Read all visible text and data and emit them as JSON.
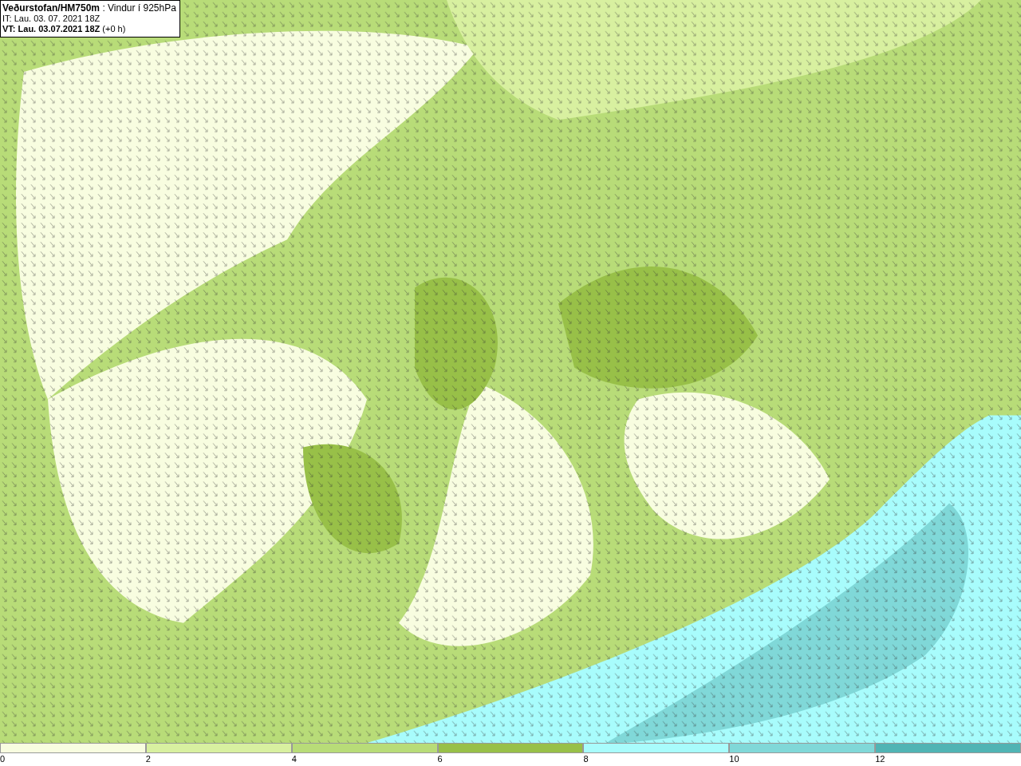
{
  "header": {
    "lines": [
      "**Veðurstofan/HM750m** : Vindur í 925hPa",
      "IT: Lau. 03. 07. 2021 18Z",
      "**VT: Lau. 03.07.2021 18Z** (+0 h)"
    ]
  },
  "legend": [
    {
      "label": "0",
      "color": "#f8fde0"
    },
    {
      "label": "2",
      "color": "#d8f0a0"
    },
    {
      "label": "4",
      "color": "#b8dc78"
    },
    {
      "label": "6",
      "color": "#98c048"
    },
    {
      "label": "8",
      "color": "#a8fcfc"
    },
    {
      "label": "10",
      "color": "#80d8d8"
    },
    {
      "label": "12",
      "color": "#50b4b4"
    }
  ]
}
